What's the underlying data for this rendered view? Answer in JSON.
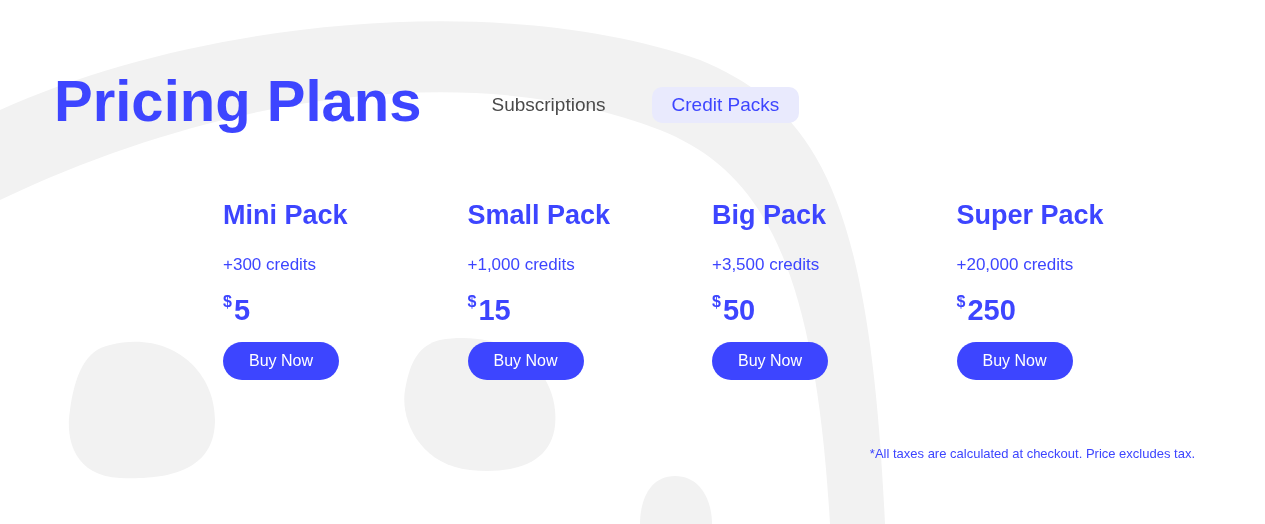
{
  "title": "Pricing Plans",
  "tabs": [
    {
      "label": "Subscriptions",
      "selected": false
    },
    {
      "label": "Credit Packs",
      "selected": true
    }
  ],
  "packs": [
    {
      "name": "Mini Pack",
      "credits": "+300 credits",
      "currency": "$",
      "amount": "5",
      "button": "Buy Now"
    },
    {
      "name": "Small Pack",
      "credits": "+1,000 credits",
      "currency": "$",
      "amount": "15",
      "button": "Buy Now"
    },
    {
      "name": "Big Pack",
      "credits": "+3,500 credits",
      "currency": "$",
      "amount": "50",
      "button": "Buy Now"
    },
    {
      "name": "Super Pack",
      "credits": "+20,000 credits",
      "currency": "$",
      "amount": "250",
      "button": "Buy Now"
    }
  ],
  "footnote": "*All taxes are calculated at checkout. Price excludes tax."
}
